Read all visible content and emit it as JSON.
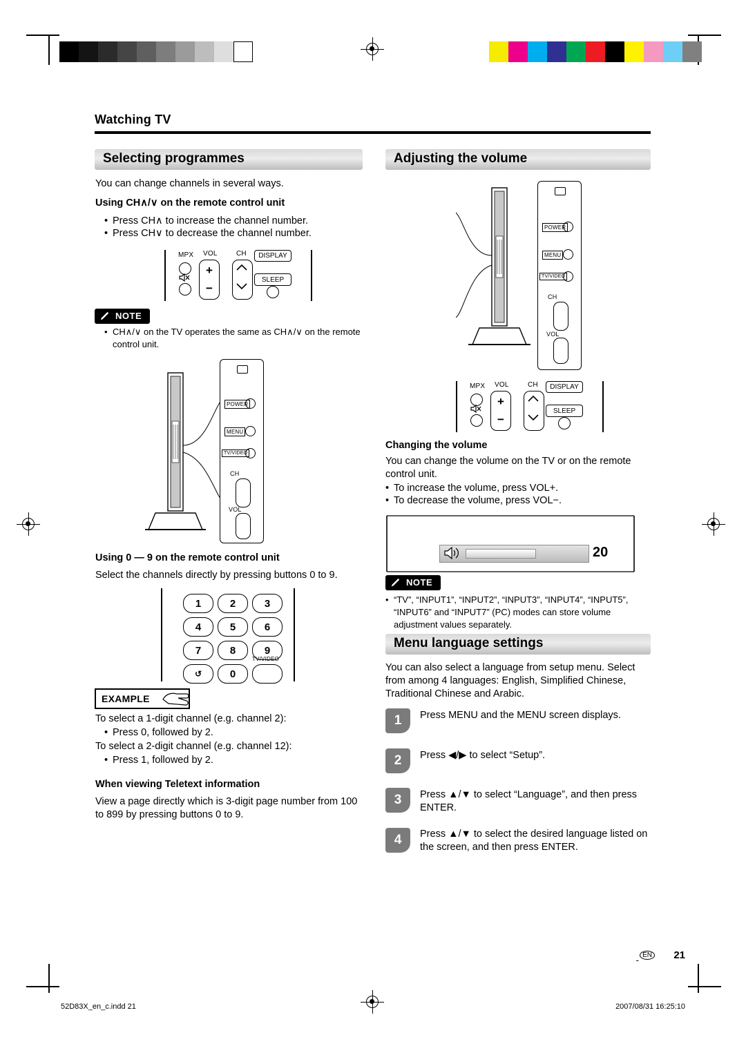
{
  "header": {
    "section": "Watching TV"
  },
  "left": {
    "banner": "Selecting programmes",
    "intro": "You can change channels in several ways.",
    "sub1": "Using CH∧/∨ on the remote control unit",
    "bullets1": [
      "Press CH∧ to increase the channel number.",
      "Press CH∨ to decrease the channel number."
    ],
    "note_label": "NOTE",
    "note1": "CH∧/∨ on the TV operates the same as CH∧/∨ on the remote control unit.",
    "sub2": "Using 0 — 9 on the remote control unit",
    "para2": "Select the channels directly by pressing buttons 0 to 9.",
    "example_label": "EXAMPLE",
    "ex_line1": "To select a 1-digit channel (e.g. channel 2):",
    "ex_b1": "Press 0, followed by 2.",
    "ex_line2": "To select a 2-digit channel (e.g. channel 12):",
    "ex_b2": "Press 1, followed by 2.",
    "sub3": "When viewing Teletext information",
    "para3": "View a page directly which is 3-digit page number from 100 to 899 by pressing buttons 0 to 9."
  },
  "right": {
    "banner1": "Adjusting the volume",
    "sub1": "Changing the volume",
    "para1": "You can change the volume on the TV or on the remote control unit.",
    "bullets": [
      "To increase the volume, press VOL+.",
      "To decrease the volume, press VOL−."
    ],
    "volume_value": "20",
    "note_label": "NOTE",
    "note1": "“TV”, “INPUT1”, “INPUT2”, “INPUT3”, “INPUT4”, “INPUT5”, “INPUT6” and “INPUT7” (PC) modes can store volume adjustment values separately.",
    "banner2": "Menu language settings",
    "para2": "You can also select a language from setup menu. Select from among 4 languages: English, Simplified Chinese, Traditional Chinese and Arabic.",
    "steps": [
      {
        "num": "1",
        "text": "Press MENU and the MENU screen displays."
      },
      {
        "num": "2",
        "text": "Press ◀/▶ to select “Setup”."
      },
      {
        "num": "3",
        "text": "Press ▲/▼ to select “Language”, and then press ENTER."
      },
      {
        "num": "4",
        "text": "Press ▲/▼ to select the desired language listed on the screen, and then press ENTER."
      }
    ]
  },
  "remote_keys": {
    "mpx": "MPX",
    "vol": "VOL",
    "ch": "CH",
    "display": "DISPLAY",
    "sleep": "SLEEP",
    "plus": "+",
    "minus": "−"
  },
  "tv_panel_labels": {
    "power": "POWER",
    "menu": "MENU",
    "tvvideo": "TV/VIDEO",
    "ch": "CH",
    "vol": "VOL"
  },
  "keypad": {
    "keys": [
      "1",
      "2",
      "3",
      "4",
      "5",
      "6",
      "7",
      "8",
      "9",
      "↺",
      "0",
      ""
    ],
    "tvvideo": "TV/VIDEO"
  },
  "footer": {
    "file": "52D83X_en_c.indd   21",
    "stamp": "2007/08/31   16:25:10",
    "page": "21",
    "en": "EN"
  }
}
